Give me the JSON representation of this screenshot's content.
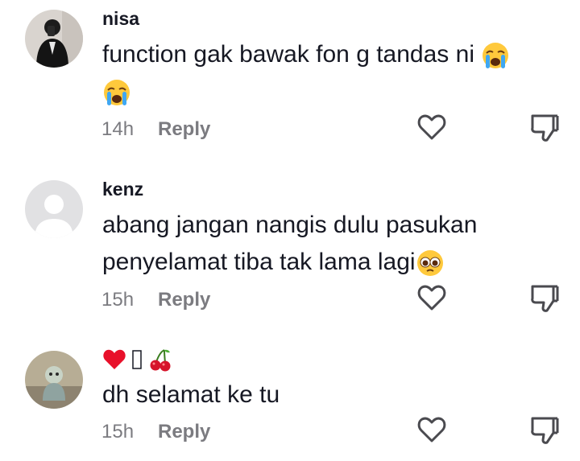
{
  "comments": [
    {
      "username": "nisa",
      "text": "function gak bawak fon g tandas ni",
      "time": "14h",
      "reply_label": "Reply",
      "emoji": [
        "crying-face",
        "crying-face"
      ]
    },
    {
      "username": "kenz",
      "text_line1": "abang jangan nangis dulu pasukan",
      "text_line2": "penyelamat tiba tak lama lagi",
      "time": "15h",
      "reply_label": "Reply",
      "emoji": [
        "pleading-face"
      ]
    },
    {
      "username": "",
      "username_glyphs": [
        "red-heart",
        "missing-glyph",
        "cherries"
      ],
      "text": "dh selamat ke tu",
      "time": "15h",
      "reply_label": "Reply"
    }
  ],
  "colors": {
    "text": "#161823",
    "muted": "#7b7b80",
    "icon": "#4a4a4f"
  }
}
